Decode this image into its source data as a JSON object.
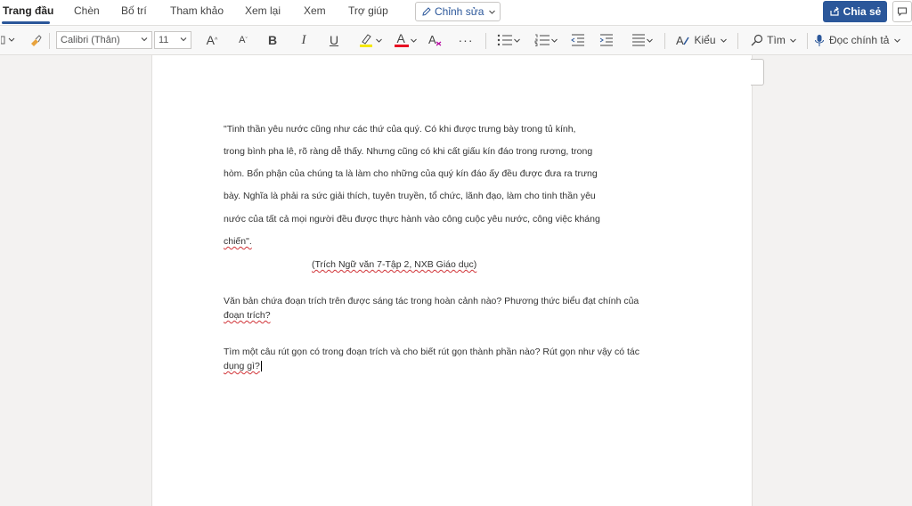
{
  "menu": {
    "tabs": [
      "Trang đầu",
      "Chèn",
      "Bố trí",
      "Tham khảo",
      "Xem lại",
      "Xem",
      "Trợ giúp"
    ],
    "edit_mode": "Chỉnh sửa",
    "share": "Chia sẻ"
  },
  "toolbar": {
    "font_name": "Calibri (Thân)",
    "font_size": "11",
    "grow_font": "A",
    "shrink_font": "A",
    "bold": "B",
    "italic": "I",
    "underline": "U",
    "font_color": "A",
    "more": "···",
    "styles_label": "Kiểu",
    "find_label": "Tìm",
    "dictate_label": "Đọc chính tả",
    "colors": {
      "highlight": "#f5e900",
      "font_color": "#e81123",
      "accent": "#2b579a"
    }
  },
  "document": {
    "quote_lines": [
      "\"Tinh thần yêu nước cũng như các thứ của quý. Có khi được trưng bày trong tủ kính,",
      "trong bình pha lê, rõ ràng dễ thấy. Nhưng cũng có khi cất giấu kín đáo trong rương, trong",
      "hòm. Bổn phận của chúng ta là làm cho những của quý kín đáo ấy đều được đưa ra trưng",
      "bày. Nghĩa là phải ra sức giải thích, tuyên truyền, tổ chức, lãnh đạo, làm cho tinh thần yêu",
      "nước của tất cả mọi người đều được thực hành vào công cuộc yêu nước, công việc kháng",
      "chiến\"."
    ],
    "source": "(Trích Ngữ văn 7-Tập 2, NXB Giáo dục)",
    "question1_lines": [
      "Văn bản chứa đoạn trích trên được sáng tác trong hoàn cảnh nào? Phương thức biểu đạt chính của",
      "đoạn trích?"
    ],
    "question2_lines": [
      "Tìm một câu rút gọn có trong đoạn trích và cho biết rút gọn thành phần nào? Rút gọn như vậy có tác",
      "dụng gì?"
    ]
  }
}
